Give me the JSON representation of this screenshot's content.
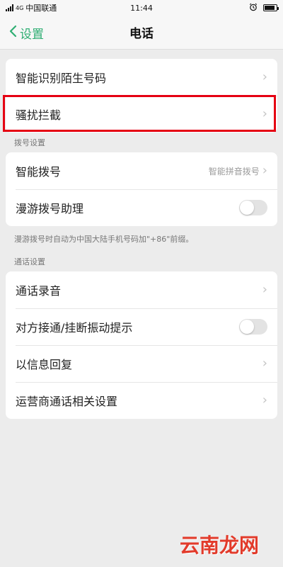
{
  "status_bar": {
    "carrier": "中国联通",
    "network": "4G",
    "time": "11:44",
    "battery_level": 0.85
  },
  "header": {
    "back_label": "设置",
    "title": "电话"
  },
  "group1": [
    {
      "label": "智能识别陌生号码"
    },
    {
      "label": "骚扰拦截"
    }
  ],
  "dial_section": {
    "title": "拨号设置",
    "smart_dial": {
      "label": "智能拨号",
      "value": "智能拼音拨号"
    },
    "roaming": {
      "label": "漫游拨号助理",
      "enabled": false
    },
    "note": "漫游拨号时自动为中国大陆手机号码加\"+86\"前缀。"
  },
  "call_section": {
    "title": "通话设置",
    "items": [
      {
        "label": "通话录音"
      },
      {
        "label": "对方接通/挂断振动提示",
        "enabled": false
      },
      {
        "label": "以信息回复"
      },
      {
        "label": "运营商通话相关设置"
      }
    ]
  },
  "watermark": "云南龙网",
  "colors": {
    "accent": "#2fae73",
    "highlight": "#e50012",
    "watermark": "#e23b2b"
  },
  "icons": [
    "signal-icon",
    "alarm-icon",
    "battery-icon",
    "back-chevron-icon",
    "chevron-right-icon"
  ]
}
